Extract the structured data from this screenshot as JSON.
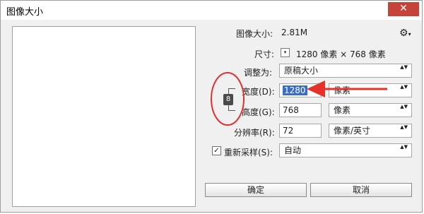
{
  "window": {
    "title": "图像大小",
    "close_glyph": "✕"
  },
  "image_size": {
    "label": "图像大小:",
    "value": "2.81M"
  },
  "settings_gear": {
    "glyph": "⚙",
    "caret": "▾"
  },
  "dimensions": {
    "label": "尺寸:",
    "dropdown_glyph": "▾",
    "value": "1280 像素 × 768 像素"
  },
  "fit_to": {
    "label": "调整为:",
    "value": "原稿大小"
  },
  "width": {
    "label": "宽度(D):",
    "value": "1280",
    "unit": "像素"
  },
  "height": {
    "label": "高度(G):",
    "value": "768",
    "unit": "像素"
  },
  "resolution": {
    "label": "分辨率(R):",
    "value": "72",
    "unit": "像素/英寸"
  },
  "resample": {
    "checked": true,
    "check_glyph": "✓",
    "label": "重新采样(S):",
    "value": "自动"
  },
  "link_icon_glyph": "8",
  "select_arrows": "▲▼",
  "buttons": {
    "ok": "确定",
    "cancel": "取消"
  },
  "annotation_colors": {
    "circle": "#e03030",
    "arrow": "#e8302a"
  },
  "colors": {
    "selection": "#3a6dc4",
    "close": "#c7433a"
  }
}
